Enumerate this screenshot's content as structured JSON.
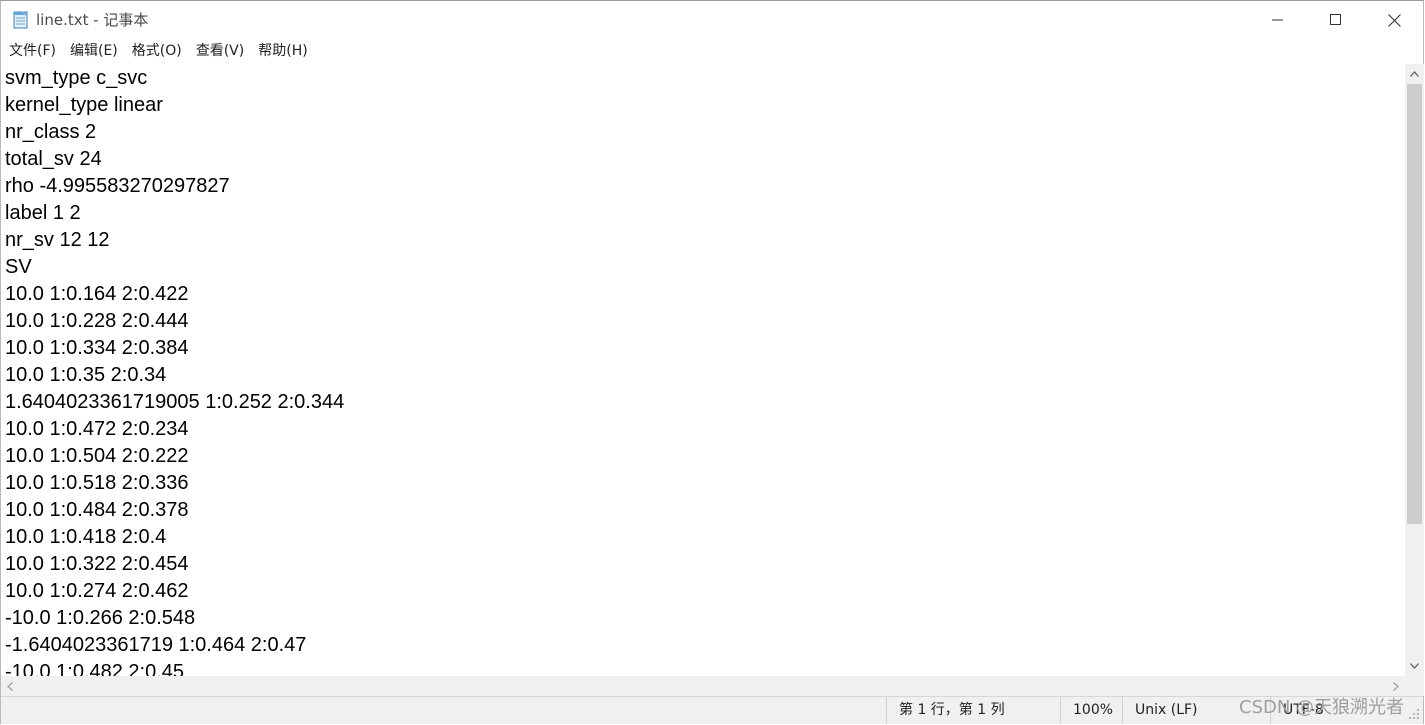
{
  "window": {
    "title": "line.txt - 记事本",
    "icon": "notepad-icon"
  },
  "menu": [
    {
      "label": "文件(F)"
    },
    {
      "label": "编辑(E)"
    },
    {
      "label": "格式(O)"
    },
    {
      "label": "查看(V)"
    },
    {
      "label": "帮助(H)"
    }
  ],
  "editor": {
    "lines": [
      "svm_type c_svc",
      "kernel_type linear",
      "nr_class 2",
      "total_sv 24",
      "rho -4.995583270297827",
      "label 1 2",
      "nr_sv 12 12",
      "SV",
      "10.0 1:0.164 2:0.422",
      "10.0 1:0.228 2:0.444",
      "10.0 1:0.334 2:0.384",
      "10.0 1:0.35 2:0.34",
      "1.6404023361719005 1:0.252 2:0.344",
      "10.0 1:0.472 2:0.234",
      "10.0 1:0.504 2:0.222",
      "10.0 1:0.518 2:0.336",
      "10.0 1:0.484 2:0.378",
      "10.0 1:0.418 2:0.4",
      "10.0 1:0.322 2:0.454",
      "10.0 1:0.274 2:0.462",
      "-10.0 1:0.266 2:0.548",
      "-1.6404023361719 1:0.464 2:0.47",
      "-10.0 1:0.482 2:0.45"
    ]
  },
  "status": {
    "position": "第 1 行，第 1 列",
    "zoom": "100%",
    "line_ending": "Unix (LF)",
    "encoding": "UTF-8"
  },
  "watermark": "CSDN @天狼溯光者",
  "scroll": {
    "vertical_position": 0
  },
  "colors": {
    "chrome": "#f0f0f0",
    "text": "#000000"
  }
}
